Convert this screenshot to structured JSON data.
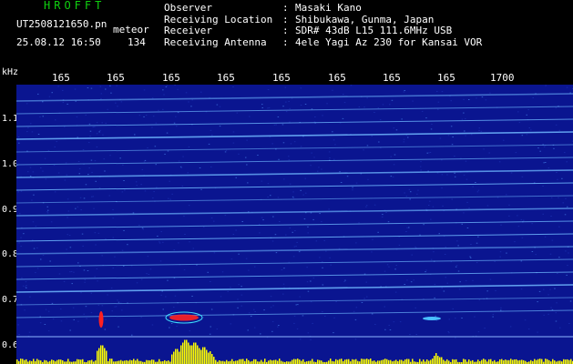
{
  "header": {
    "app_title": "HROFFT",
    "filename": "UT2508121650.pn",
    "meteor_label": "meteor",
    "datetime": "25.08.12 16:50",
    "count": "134"
  },
  "info": [
    {
      "label": "Observer",
      "value": "Masaki Kano"
    },
    {
      "label": "Receiving Location",
      "value": "Shibukawa, Gunma, Japan"
    },
    {
      "label": "Receiver",
      "value": "SDR# 43dB L15 111.6MHz USB"
    },
    {
      "label": "Receiving Antenna",
      "value": "4ele Yagi Az 230 for Kansai VOR"
    }
  ],
  "axis": {
    "unit": "kHz",
    "freq_ticks": [
      "165",
      "165",
      "165",
      "165",
      "165",
      "165",
      "165",
      "165",
      "1700"
    ],
    "y_ticks": [
      "1.1",
      "1.0",
      "0.9",
      "0.8",
      "0.7",
      "0.6"
    ]
  },
  "colors": {
    "background": "#0a1590",
    "noise_line": "#6fb8ff",
    "meteor_red": "#ff2020",
    "level_yellow": "#ffff00",
    "title_green": "#10d010"
  }
}
